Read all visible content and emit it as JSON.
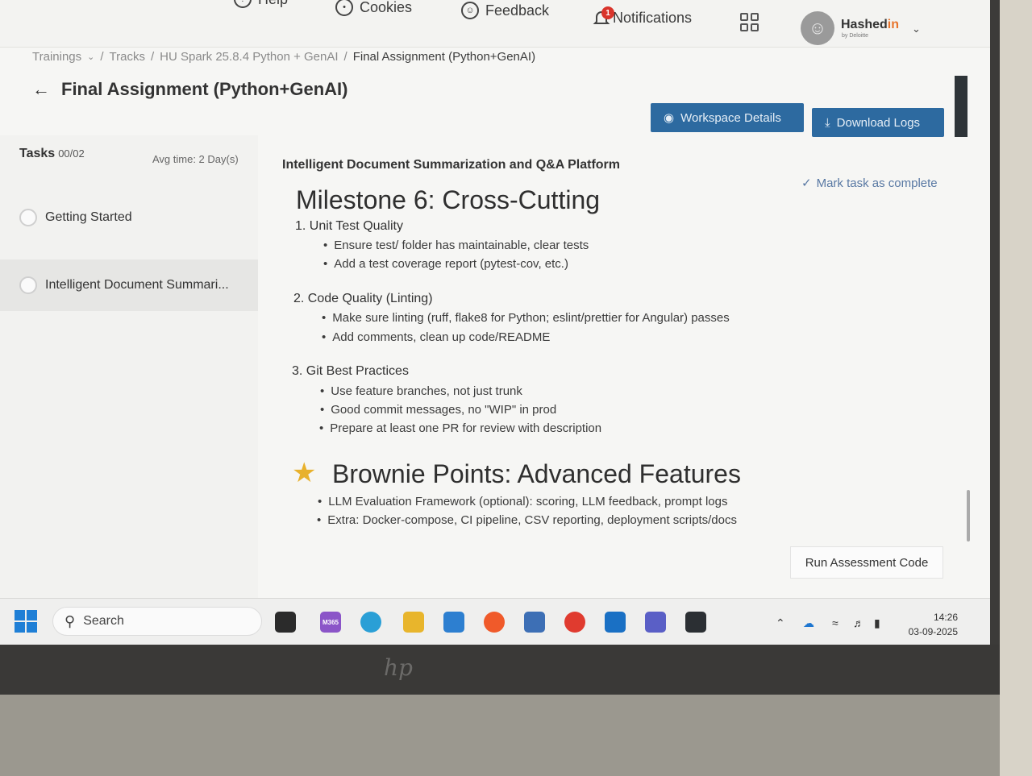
{
  "nav": {
    "help": "Help",
    "cookies": "Cookies",
    "feedback": "Feedback",
    "notifications": "Notifications",
    "notif_badge": "1",
    "brand_main": "Hashed",
    "brand_in": "in",
    "brand_sub": "by Deloitte"
  },
  "breadcrumb": {
    "items": [
      "Trainings",
      "Tracks",
      "HU Spark 25.8.4 Python + GenAI",
      "Final Assignment (Python+GenAI)"
    ],
    "sep": "/"
  },
  "page": {
    "title": "Final Assignment (Python+GenAI)",
    "workspace_btn": "Workspace Details",
    "download_btn": "Download Logs"
  },
  "sidebar": {
    "tasks_label": "Tasks",
    "tasks_count": "00/02",
    "avg_time": "Avg time: 2 Day(s)",
    "items": [
      {
        "label": "Getting Started"
      },
      {
        "label": "Intelligent Document Summari..."
      }
    ]
  },
  "content": {
    "task_title": "Intelligent Document Summarization and Q&A Platform",
    "mark_complete": "Mark task as complete",
    "milestone_title": "Milestone 6: Cross-Cutting",
    "sections": [
      {
        "heading": "1. Unit Test Quality",
        "items": [
          "Ensure test/ folder has maintainable, clear tests",
          "Add a test coverage report (pytest-cov, etc.)"
        ]
      },
      {
        "heading": "2. Code Quality (Linting)",
        "items": [
          "Make sure linting (ruff, flake8 for Python; eslint/prettier for Angular) passes",
          "Add comments, clean up code/README"
        ]
      },
      {
        "heading": "3. Git Best Practices",
        "items": [
          "Use feature branches, not just trunk",
          "Good commit messages, no \"WIP\" in prod",
          "Prepare at least one PR for review with description"
        ]
      }
    ],
    "brownie_title": "Brownie Points: Advanced Features",
    "brownie_items": [
      "LLM Evaluation Framework (optional): scoring, LLM feedback, prompt logs",
      "Extra: Docker-compose, CI pipeline, CSV reporting, deployment scripts/docs"
    ],
    "run_btn": "Run Assessment Code"
  },
  "taskbar": {
    "search": "Search",
    "m365": "M365",
    "time": "14:26",
    "date": "03-09-2025"
  },
  "colors": {
    "accent": "#2d6aa0",
    "link": "#5878a3",
    "star": "#e8b12c",
    "windows": "#1f7fd6"
  }
}
